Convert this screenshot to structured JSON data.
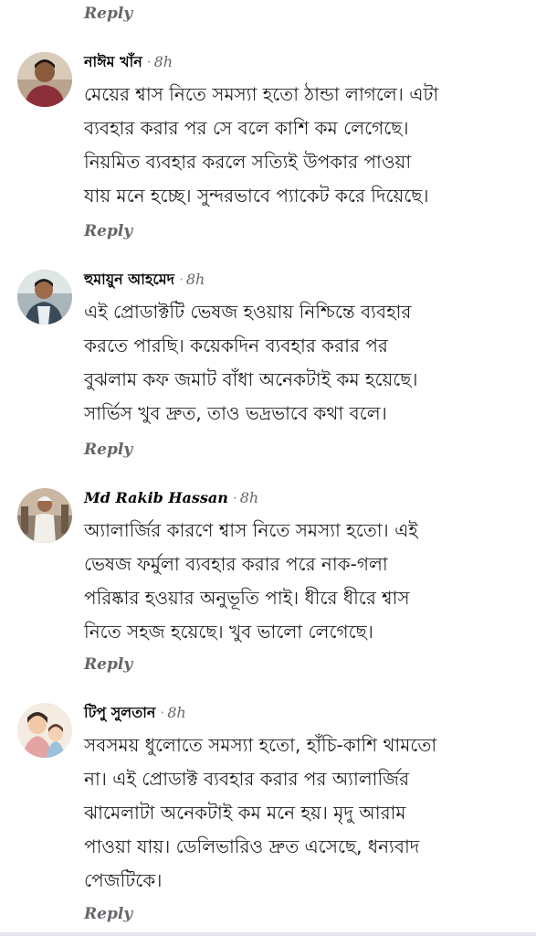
{
  "reply_label": "Reply",
  "comments": [
    {
      "name": "নাঈম খাঁন",
      "time": "8h",
      "text": "মেয়ের শ্বাস নিতে সমস্যা হতো ঠান্ডা লাগলে। এটা\nব্যবহার করার পর সে বলে কাশি কম লেগেছে।\nনিয়মিত ব্যবহার করলে সত্যিই উপকার পাওয়া\nযায় মনে হচ্ছে। সুন্দরভাবে প্যাকেট করে দিয়েছে।"
    },
    {
      "name": "হুমায়ুন আহমেদ",
      "time": "8h",
      "text": "এই প্রোডাক্টটি ভেষজ হওয়ায় নিশ্চিন্তে ব্যবহার\nকরতে পারছি। কয়েকদিন ব্যবহার করার পর\nবুঝলাম কফ জমাট বাঁধা অনেকটাই কম হয়েছে।\nসার্ভিস খুব দ্রুত, তাও ভদ্রভাবে কথা বলে।"
    },
    {
      "name": "Md Rakib Hassan",
      "time": "8h",
      "text": "অ্যালার্জির কারণে শ্বাস নিতে সমস্যা হতো। এই\nভেষজ ফর্মুলা ব্যবহার করার পরে নাক-গলা\nপরিষ্কার হওয়ার অনুভূতি পাই। ধীরে ধীরে শ্বাস\nনিতে সহজ হয়েছে। খুব ভালো লেগেছে।"
    },
    {
      "name": "টিপু সুলতান",
      "time": "8h",
      "text": "সবসময় ধুলোতে সমস্যা হতো, হাঁচি-কাশি থামতো\nনা। এই প্রোডাক্ট ব্যবহার করার পর অ্যালার্জির\nঝামেলাটা অনেকটাই কম মনে হয়। মৃদু আরাম\nপাওয়া যায়। ডেলিভারিও দ্রুত এসেছে, ধন্যবাদ\nপেজটিকে।"
    }
  ],
  "colors": {
    "name": "#050505",
    "meta": "#65676b",
    "text": "#1c1e21"
  }
}
